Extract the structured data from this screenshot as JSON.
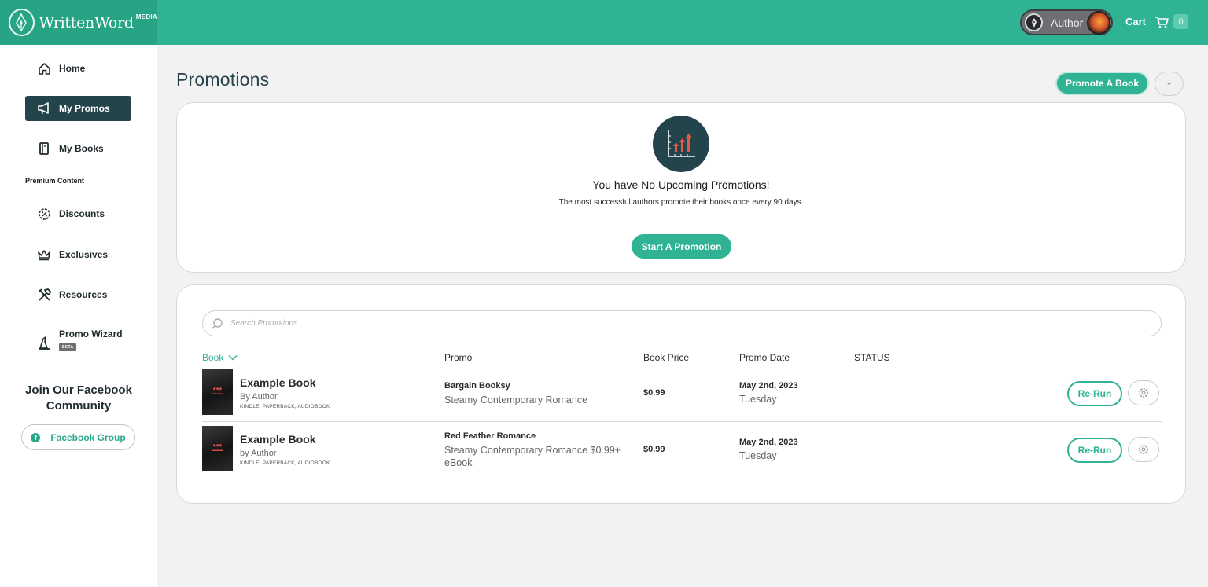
{
  "header": {
    "logo_text": "WrittenWord",
    "logo_suffix": "MEDIA",
    "author_label": "Author",
    "cart_label": "Cart",
    "cart_count": "0",
    "brand_color": "#2fb394"
  },
  "sidebar": {
    "items": [
      {
        "label": "Home",
        "icon": "home-icon"
      },
      {
        "label": "My Promos",
        "icon": "megaphone-icon",
        "active": true
      },
      {
        "label": "My Books",
        "icon": "book-icon"
      },
      {
        "label": "Discounts",
        "icon": "discount-icon"
      },
      {
        "label": "Exclusives",
        "icon": "crown-icon"
      },
      {
        "label": "Resources",
        "icon": "tools-icon"
      },
      {
        "label": "Promo Wizard",
        "icon": "wizard-hat-icon",
        "badge": "BETA"
      }
    ],
    "section_label": "Premium Content",
    "facebook": {
      "title": "Join Our Facebook Community",
      "button_label": "Facebook Group"
    }
  },
  "main": {
    "title": "Promotions",
    "promote_button": "Promote A Book",
    "empty_state": {
      "title": "You have No Upcoming Promotions!",
      "subtitle": "The most successful authors promote their books once every 90 days.",
      "button": "Start A Promotion"
    },
    "search": {
      "placeholder": "Search Promotions"
    },
    "table": {
      "columns": [
        "Book",
        "Promo",
        "Book Price",
        "Promo Date",
        "STATUS"
      ],
      "rows": [
        {
          "title": "Example Book",
          "author": "By Author",
          "formats": "KINDLE, PAPERBACK, AUDIOBOOK",
          "promo": "Bargain Booksy",
          "category": "Steamy Contemporary Romance",
          "price": "$0.99",
          "date": "May 2nd, 2023",
          "day": "Tuesday",
          "action": "Re-Run"
        },
        {
          "title": "Example Book",
          "author": "by Author",
          "formats": "KINDLE, PAPERBACK, AUDIOBOOK",
          "promo": "Red Feather Romance",
          "category": "Steamy Contemporary Romance $0.99+ eBook",
          "price": "$0.99",
          "date": "May 2nd, 2023",
          "day": "Tuesday",
          "action": "Re-Run"
        }
      ]
    }
  }
}
